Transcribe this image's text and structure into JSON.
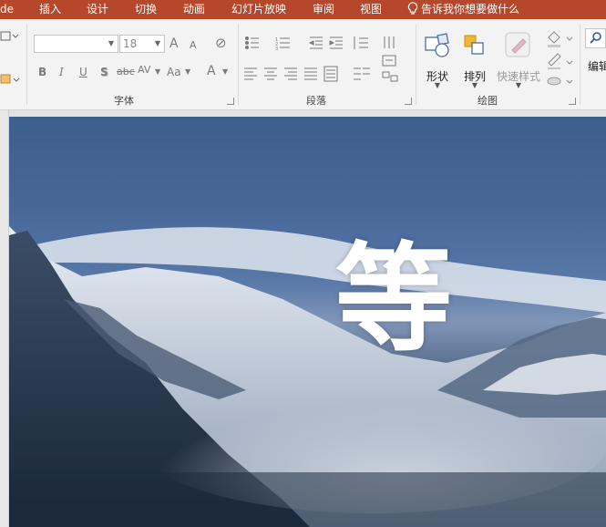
{
  "menubar": {
    "cut_item": "de",
    "items": [
      "插入",
      "设计",
      "切换",
      "动画",
      "幻灯片放映",
      "审阅",
      "视图"
    ],
    "tell_me": "告诉我你想要做什么"
  },
  "ribbon": {
    "font": {
      "label": "字体",
      "font_name": "",
      "font_size": "18",
      "bold": "B",
      "italic": "I",
      "underline": "U",
      "shadow": "S",
      "strike": "abc",
      "spacing": "AV",
      "case": "Aa",
      "color": "A",
      "grow": "A",
      "shrink": "A"
    },
    "paragraph": {
      "label": "段落"
    },
    "drawing": {
      "label": "绘图",
      "shapes": "形状",
      "arrange": "排列",
      "quick_styles": "快速样式"
    },
    "editing": {
      "label": "编辑"
    }
  },
  "slide": {
    "title_char": "等"
  },
  "colors": {
    "accent": "#b7472a",
    "ribbon_bg": "#f3f3f3"
  }
}
